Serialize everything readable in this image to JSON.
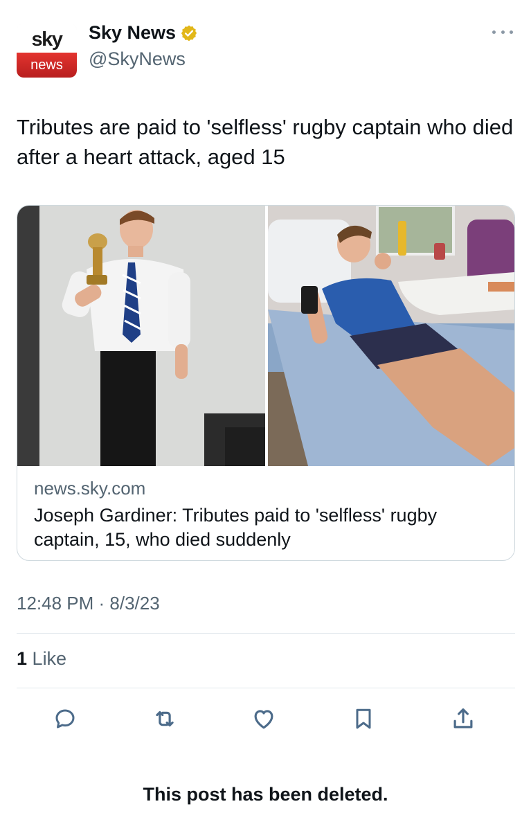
{
  "author": {
    "logo_top": "sky",
    "logo_bottom": "news",
    "display_name": "Sky News",
    "handle": "@SkyNews",
    "verified_icon": "gold-verified-badge-icon"
  },
  "tweet": {
    "text": "Tributes are paid to 'selfless' rugby captain who died after a heart attack, aged 15"
  },
  "card": {
    "domain": "news.sky.com",
    "title": "Joseph Gardiner: Tributes paid to 'selfless' rugby captain, 15, who died suddenly"
  },
  "meta": {
    "timestamp": "12:48 PM · 8/3/23",
    "likes_count": "1",
    "likes_label": "Like"
  },
  "actions": [
    {
      "name": "reply-icon"
    },
    {
      "name": "retweet-icon"
    },
    {
      "name": "like-icon"
    },
    {
      "name": "bookmark-icon"
    },
    {
      "name": "share-icon"
    }
  ],
  "notice": {
    "text": "This post has been deleted."
  },
  "colors": {
    "text": "#0f1419",
    "secondary": "#536471",
    "border": "#cfd9de",
    "brand_red": "#e3342f",
    "verified_gold": "#e2b719"
  }
}
